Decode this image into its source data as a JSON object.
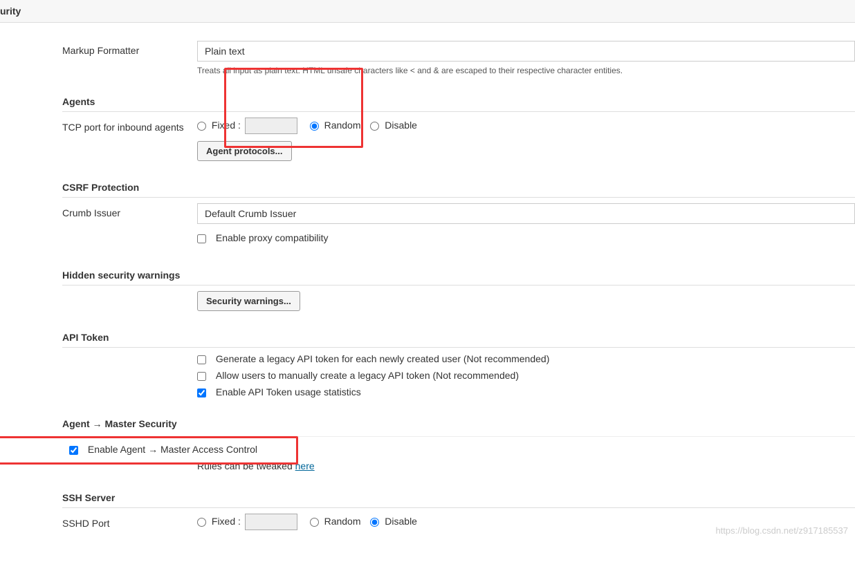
{
  "topbar": {
    "title_fragment": "urity"
  },
  "markup": {
    "label": "Markup Formatter",
    "value": "Plain text",
    "help": "Treats all input as plain text. HTML unsafe characters like < and & are escaped to their respective character entities."
  },
  "agents": {
    "heading": "Agents",
    "tcp_label": "TCP port for inbound agents",
    "fixed_label": "Fixed :",
    "random_label": "Random",
    "disable_label": "Disable",
    "selected": "random",
    "btn": "Agent protocols..."
  },
  "csrf": {
    "heading": "CSRF Protection",
    "crumb_label": "Crumb Issuer",
    "crumb_value": "Default Crumb Issuer",
    "proxy_label": "Enable proxy compatibility"
  },
  "hidden_warnings": {
    "heading": "Hidden security warnings",
    "btn": "Security warnings..."
  },
  "api_token": {
    "heading": "API Token",
    "opt1": "Generate a legacy API token for each newly created user (Not recommended)",
    "opt2": "Allow users to manually create a legacy API token (Not recommended)",
    "opt3": "Enable API Token usage statistics"
  },
  "agent_master": {
    "heading": "Agent → Master Security",
    "enable_label": "Enable Agent → Master Access Control",
    "rules_prefix": "Rules can be tweaked ",
    "rules_link": "here"
  },
  "ssh": {
    "heading": "SSH Server",
    "port_label": "SSHD Port",
    "fixed_label": "Fixed :",
    "random_label": "Random",
    "disable_label": "Disable",
    "selected": "disable"
  },
  "watermark": "https://blog.csdn.net/z917185537"
}
